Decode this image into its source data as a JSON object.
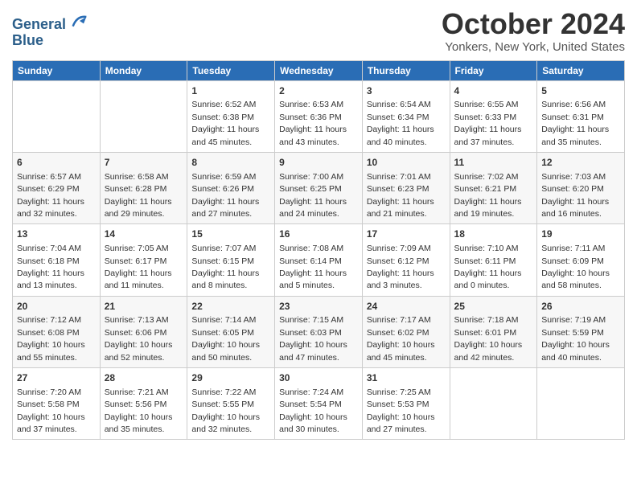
{
  "header": {
    "logo_line1": "General",
    "logo_line2": "Blue",
    "month_title": "October 2024",
    "location": "Yonkers, New York, United States"
  },
  "weekdays": [
    "Sunday",
    "Monday",
    "Tuesday",
    "Wednesday",
    "Thursday",
    "Friday",
    "Saturday"
  ],
  "weeks": [
    [
      null,
      null,
      {
        "day": "1",
        "sunrise": "6:52 AM",
        "sunset": "6:38 PM",
        "daylight": "11 hours and 45 minutes."
      },
      {
        "day": "2",
        "sunrise": "6:53 AM",
        "sunset": "6:36 PM",
        "daylight": "11 hours and 43 minutes."
      },
      {
        "day": "3",
        "sunrise": "6:54 AM",
        "sunset": "6:34 PM",
        "daylight": "11 hours and 40 minutes."
      },
      {
        "day": "4",
        "sunrise": "6:55 AM",
        "sunset": "6:33 PM",
        "daylight": "11 hours and 37 minutes."
      },
      {
        "day": "5",
        "sunrise": "6:56 AM",
        "sunset": "6:31 PM",
        "daylight": "11 hours and 35 minutes."
      }
    ],
    [
      {
        "day": "6",
        "sunrise": "6:57 AM",
        "sunset": "6:29 PM",
        "daylight": "11 hours and 32 minutes."
      },
      {
        "day": "7",
        "sunrise": "6:58 AM",
        "sunset": "6:28 PM",
        "daylight": "11 hours and 29 minutes."
      },
      {
        "day": "8",
        "sunrise": "6:59 AM",
        "sunset": "6:26 PM",
        "daylight": "11 hours and 27 minutes."
      },
      {
        "day": "9",
        "sunrise": "7:00 AM",
        "sunset": "6:25 PM",
        "daylight": "11 hours and 24 minutes."
      },
      {
        "day": "10",
        "sunrise": "7:01 AM",
        "sunset": "6:23 PM",
        "daylight": "11 hours and 21 minutes."
      },
      {
        "day": "11",
        "sunrise": "7:02 AM",
        "sunset": "6:21 PM",
        "daylight": "11 hours and 19 minutes."
      },
      {
        "day": "12",
        "sunrise": "7:03 AM",
        "sunset": "6:20 PM",
        "daylight": "11 hours and 16 minutes."
      }
    ],
    [
      {
        "day": "13",
        "sunrise": "7:04 AM",
        "sunset": "6:18 PM",
        "daylight": "11 hours and 13 minutes."
      },
      {
        "day": "14",
        "sunrise": "7:05 AM",
        "sunset": "6:17 PM",
        "daylight": "11 hours and 11 minutes."
      },
      {
        "day": "15",
        "sunrise": "7:07 AM",
        "sunset": "6:15 PM",
        "daylight": "11 hours and 8 minutes."
      },
      {
        "day": "16",
        "sunrise": "7:08 AM",
        "sunset": "6:14 PM",
        "daylight": "11 hours and 5 minutes."
      },
      {
        "day": "17",
        "sunrise": "7:09 AM",
        "sunset": "6:12 PM",
        "daylight": "11 hours and 3 minutes."
      },
      {
        "day": "18",
        "sunrise": "7:10 AM",
        "sunset": "6:11 PM",
        "daylight": "11 hours and 0 minutes."
      },
      {
        "day": "19",
        "sunrise": "7:11 AM",
        "sunset": "6:09 PM",
        "daylight": "10 hours and 58 minutes."
      }
    ],
    [
      {
        "day": "20",
        "sunrise": "7:12 AM",
        "sunset": "6:08 PM",
        "daylight": "10 hours and 55 minutes."
      },
      {
        "day": "21",
        "sunrise": "7:13 AM",
        "sunset": "6:06 PM",
        "daylight": "10 hours and 52 minutes."
      },
      {
        "day": "22",
        "sunrise": "7:14 AM",
        "sunset": "6:05 PM",
        "daylight": "10 hours and 50 minutes."
      },
      {
        "day": "23",
        "sunrise": "7:15 AM",
        "sunset": "6:03 PM",
        "daylight": "10 hours and 47 minutes."
      },
      {
        "day": "24",
        "sunrise": "7:17 AM",
        "sunset": "6:02 PM",
        "daylight": "10 hours and 45 minutes."
      },
      {
        "day": "25",
        "sunrise": "7:18 AM",
        "sunset": "6:01 PM",
        "daylight": "10 hours and 42 minutes."
      },
      {
        "day": "26",
        "sunrise": "7:19 AM",
        "sunset": "5:59 PM",
        "daylight": "10 hours and 40 minutes."
      }
    ],
    [
      {
        "day": "27",
        "sunrise": "7:20 AM",
        "sunset": "5:58 PM",
        "daylight": "10 hours and 37 minutes."
      },
      {
        "day": "28",
        "sunrise": "7:21 AM",
        "sunset": "5:56 PM",
        "daylight": "10 hours and 35 minutes."
      },
      {
        "day": "29",
        "sunrise": "7:22 AM",
        "sunset": "5:55 PM",
        "daylight": "10 hours and 32 minutes."
      },
      {
        "day": "30",
        "sunrise": "7:24 AM",
        "sunset": "5:54 PM",
        "daylight": "10 hours and 30 minutes."
      },
      {
        "day": "31",
        "sunrise": "7:25 AM",
        "sunset": "5:53 PM",
        "daylight": "10 hours and 27 minutes."
      },
      null,
      null
    ]
  ],
  "labels": {
    "sunrise": "Sunrise:",
    "sunset": "Sunset:",
    "daylight": "Daylight:"
  }
}
